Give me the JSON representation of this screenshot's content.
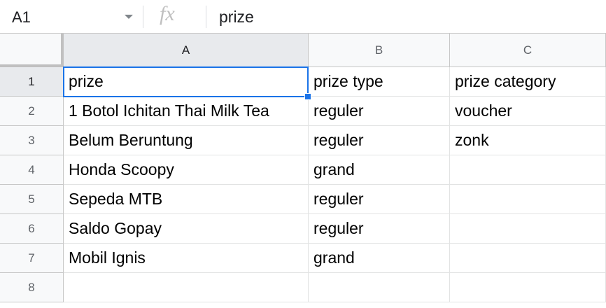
{
  "formula_bar": {
    "name_box": "A1",
    "fx_icon": "fx",
    "formula": "prize"
  },
  "columns": [
    "A",
    "B",
    "C"
  ],
  "rows": [
    "1",
    "2",
    "3",
    "4",
    "5",
    "6",
    "7",
    "8"
  ],
  "cells": [
    [
      "prize",
      "prize type",
      "prize category"
    ],
    [
      "1 Botol Ichitan Thai Milk Tea",
      "reguler",
      "voucher"
    ],
    [
      "Belum Beruntung",
      "reguler",
      "zonk"
    ],
    [
      "Honda Scoopy",
      "grand",
      ""
    ],
    [
      "Sepeda MTB",
      "reguler",
      ""
    ],
    [
      "Saldo Gopay",
      "reguler",
      ""
    ],
    [
      "Mobil Ignis",
      "grand",
      ""
    ],
    [
      "",
      "",
      ""
    ]
  ],
  "colors": {
    "selection": "#1a73e8",
    "header_bg": "#f8f9fa",
    "selected_header_bg": "#e8eaed"
  }
}
